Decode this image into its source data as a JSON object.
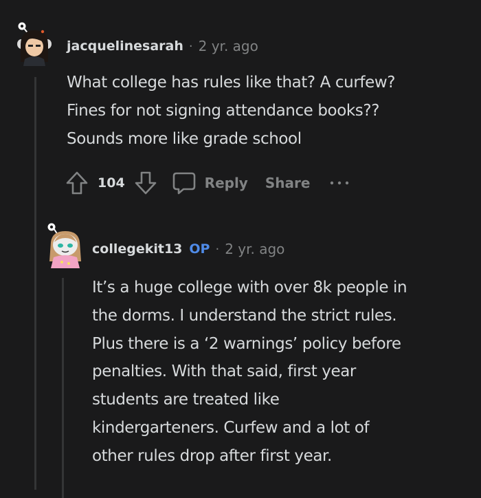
{
  "comments": [
    {
      "username": "jacquelinesarah",
      "separator": "·",
      "time": "2 yr. ago",
      "lines": [
        "What college has rules like that? A curfew?",
        "Fines for not signing attendance books??",
        "Sounds more like grade school"
      ],
      "score": "104",
      "reply_label": "Reply",
      "share_label": "Share"
    },
    {
      "username": "collegekit13",
      "badge": "OP",
      "separator": "·",
      "time": "2 yr. ago",
      "lines": [
        "It’s a huge college with over 8k people in",
        "the dorms. I understand the strict rules.",
        "Plus there is a ‘2 warnings’ policy before",
        "penalties. With that said, first year",
        "students are treated like",
        "kindergarteners. Curfew and a lot of",
        "other rules drop after first year."
      ]
    }
  ],
  "colors": {
    "background": "#1a1a1b",
    "text": "#d7dadc",
    "muted": "#818384",
    "op_badge": "#4f8be8",
    "thread_line": "#343536"
  },
  "icons": [
    "upvote-icon",
    "downvote-icon",
    "comment-icon",
    "more-options-icon"
  ]
}
